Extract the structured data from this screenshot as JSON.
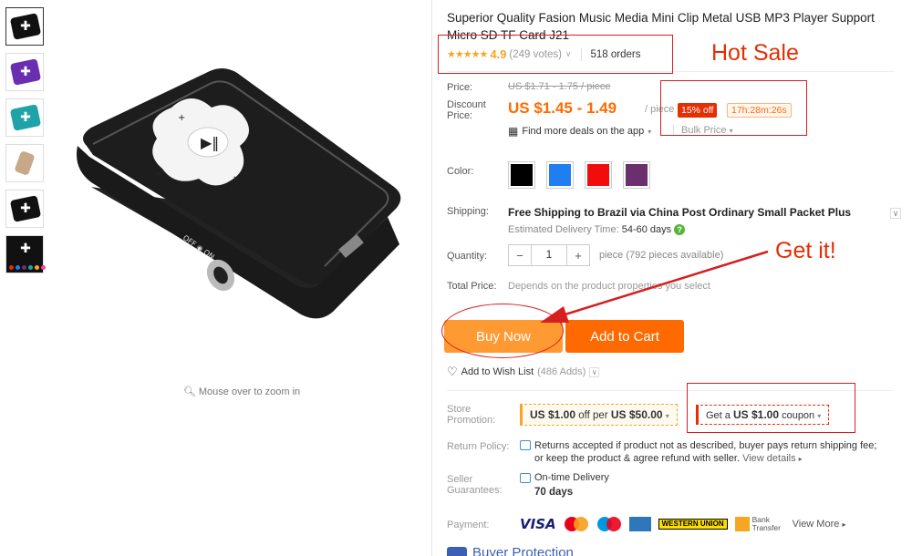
{
  "title": "Superior Quality Fasion Music Media Mini Clip Metal USB MP3 Player Support Micro SD TF Card J21",
  "rating": {
    "stars": "★★★★★",
    "value": "4.9",
    "votes": "(249 votes)",
    "orders": "518 orders"
  },
  "price": {
    "label": "Price:",
    "original": "US $1.71 - 1.75 / piece",
    "discount_label_1": "Discount",
    "discount_label_2": "Price:",
    "discounted": "US $1.45 - 1.49",
    "per": "/ piece",
    "percent_off": "15% off",
    "timer": "17h:28m:26s",
    "app_deals": "Find more deals on the app",
    "bulk": "Bulk Price"
  },
  "color": {
    "label": "Color:",
    "options": [
      "#000000",
      "#1f7ef0",
      "#f20d0d",
      "#6b2f6e"
    ]
  },
  "shipping": {
    "label": "Shipping:",
    "main": "Free Shipping to Brazil via China Post Ordinary Small Packet Plus",
    "est_label": "Estimated Delivery Time:",
    "est_value": "54-60 days"
  },
  "quantity": {
    "label": "Quantity:",
    "minus": "−",
    "value": "1",
    "plus": "+",
    "avail": "piece (792 pieces available)"
  },
  "total": {
    "label": "Total Price:",
    "note": "Depends on the product properties you select"
  },
  "buttons": {
    "buy": "Buy Now",
    "cart": "Add to Cart"
  },
  "wishlist": {
    "label": "Add to Wish List",
    "count": "(486 Adds)"
  },
  "store_promo": {
    "label_1": "Store",
    "label_2": "Promotion:",
    "offer_pre": "US $1.00",
    "offer_mid": "off per",
    "offer_amt": "US $50.00",
    "coupon_pre": "Get a",
    "coupon_amt": "US $1.00",
    "coupon_post": "coupon"
  },
  "return_policy": {
    "label": "Return Policy:",
    "text": "Returns accepted if product not as described, buyer pays return shipping fee; or keep the product & agree refund with seller.",
    "link": "View details"
  },
  "seller_guarantees": {
    "label_1": "Seller",
    "label_2": "Guarantees:",
    "item": "On-time Delivery",
    "days": "70 days"
  },
  "payment": {
    "label": "Payment:",
    "visa": "VISA",
    "wu": "WESTERN UNION",
    "bank": "Bank Transfer",
    "view_more": "View More"
  },
  "protection": "Buyer Protection",
  "zoom_hint": "Mouse over to zoom in",
  "annotations": {
    "hot_sale": "Hot Sale",
    "get_it": "Get it!"
  },
  "thumb_colors": [
    "#111111",
    "#6a2fb0",
    "#1fa3a8",
    "#c9a88a",
    "#111111",
    "#111111"
  ],
  "accent": "#ff6a00"
}
